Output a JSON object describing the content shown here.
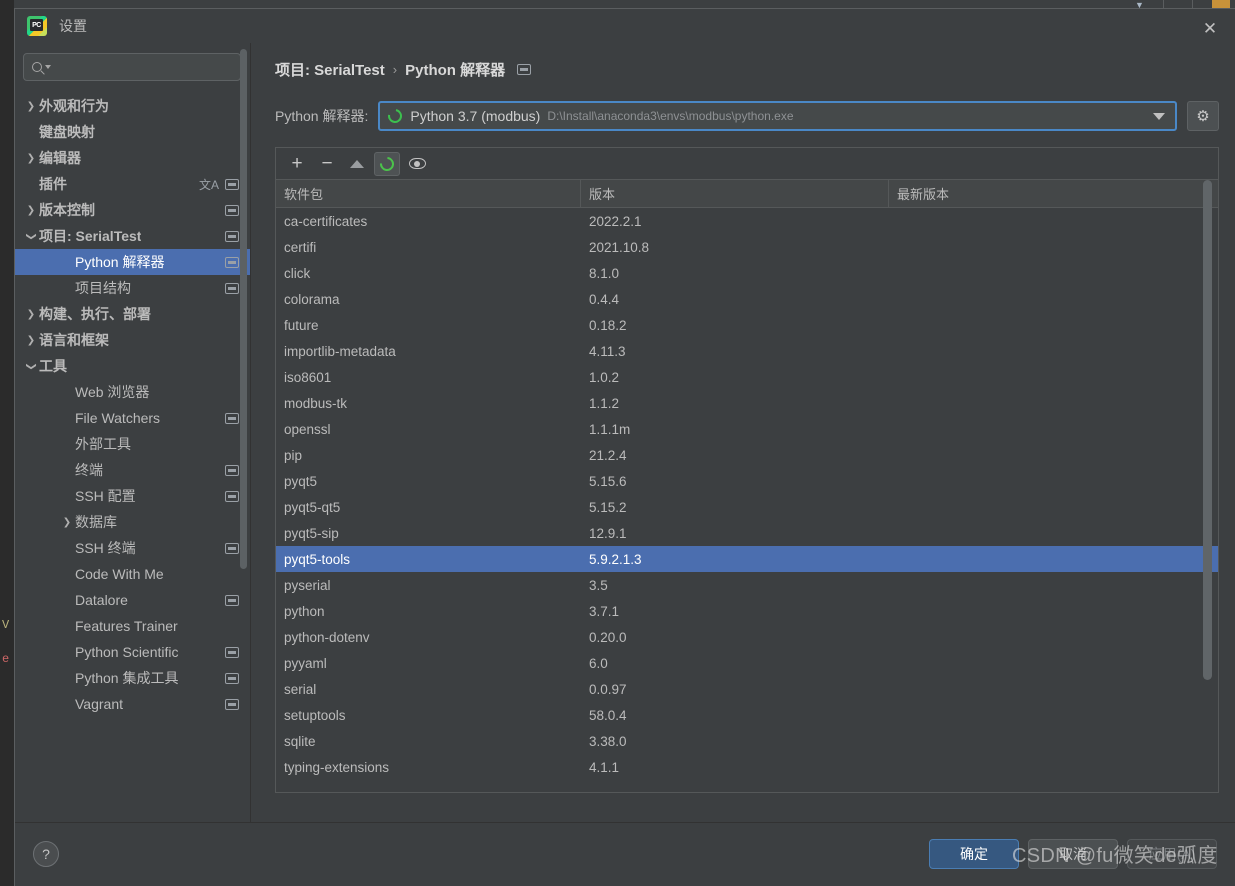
{
  "window": {
    "title": "设置",
    "app_icon": "pycharm-icon",
    "close_label": "✕"
  },
  "sidebar": {
    "search": {
      "value": "",
      "placeholder": ""
    },
    "items": [
      {
        "label": "外观和行为",
        "arrow": "collapsed",
        "indent": 0,
        "bold": true,
        "badge": "none",
        "selected": false
      },
      {
        "label": "键盘映射",
        "arrow": "none",
        "indent": 0,
        "bold": true,
        "badge": "none",
        "selected": false
      },
      {
        "label": "编辑器",
        "arrow": "collapsed",
        "indent": 0,
        "bold": true,
        "badge": "none",
        "selected": false
      },
      {
        "label": "插件",
        "arrow": "none",
        "indent": 0,
        "bold": true,
        "badge": "lang+mono",
        "selected": false
      },
      {
        "label": "版本控制",
        "arrow": "collapsed",
        "indent": 0,
        "bold": true,
        "badge": "mono",
        "selected": false
      },
      {
        "label": "项目: SerialTest",
        "arrow": "expanded",
        "indent": 0,
        "bold": true,
        "badge": "mono",
        "selected": false
      },
      {
        "label": "Python 解释器",
        "arrow": "none",
        "indent": 1,
        "bold": false,
        "badge": "mono",
        "selected": true
      },
      {
        "label": "项目结构",
        "arrow": "none",
        "indent": 1,
        "bold": false,
        "badge": "mono",
        "selected": false
      },
      {
        "label": "构建、执行、部署",
        "arrow": "collapsed",
        "indent": 0,
        "bold": true,
        "badge": "none",
        "selected": false
      },
      {
        "label": "语言和框架",
        "arrow": "collapsed",
        "indent": 0,
        "bold": true,
        "badge": "none",
        "selected": false
      },
      {
        "label": "工具",
        "arrow": "expanded",
        "indent": 0,
        "bold": true,
        "badge": "none",
        "selected": false
      },
      {
        "label": "Web 浏览器",
        "arrow": "none",
        "indent": 1,
        "bold": false,
        "badge": "none",
        "selected": false
      },
      {
        "label": "File Watchers",
        "arrow": "none",
        "indent": 1,
        "bold": false,
        "badge": "mono",
        "selected": false
      },
      {
        "label": "外部工具",
        "arrow": "none",
        "indent": 1,
        "bold": false,
        "badge": "none",
        "selected": false
      },
      {
        "label": "终端",
        "arrow": "none",
        "indent": 1,
        "bold": false,
        "badge": "mono",
        "selected": false
      },
      {
        "label": "SSH 配置",
        "arrow": "none",
        "indent": 1,
        "bold": false,
        "badge": "mono",
        "selected": false
      },
      {
        "label": "数据库",
        "arrow": "collapsed",
        "indent": 1,
        "bold": false,
        "badge": "none",
        "selected": false
      },
      {
        "label": "SSH 终端",
        "arrow": "none",
        "indent": 1,
        "bold": false,
        "badge": "mono",
        "selected": false
      },
      {
        "label": "Code With Me",
        "arrow": "none",
        "indent": 1,
        "bold": false,
        "badge": "none",
        "selected": false
      },
      {
        "label": "Datalore",
        "arrow": "none",
        "indent": 1,
        "bold": false,
        "badge": "mono",
        "selected": false
      },
      {
        "label": "Features Trainer",
        "arrow": "none",
        "indent": 1,
        "bold": false,
        "badge": "none",
        "selected": false
      },
      {
        "label": "Python Scientific",
        "arrow": "none",
        "indent": 1,
        "bold": false,
        "badge": "mono",
        "selected": false
      },
      {
        "label": "Python 集成工具",
        "arrow": "none",
        "indent": 1,
        "bold": false,
        "badge": "mono",
        "selected": false
      },
      {
        "label": "Vagrant",
        "arrow": "none",
        "indent": 1,
        "bold": false,
        "badge": "mono",
        "selected": false
      }
    ]
  },
  "content": {
    "breadcrumb": {
      "parent": "项目: SerialTest",
      "separator": "›",
      "current": "Python 解释器"
    },
    "interpreter": {
      "label": "Python 解释器:",
      "name": "Python 3.7 (modbus)",
      "path": "D:\\Install\\anaconda3\\envs\\modbus\\python.exe",
      "icon": "conda-env-icon"
    },
    "toolbar": {
      "add": "+",
      "remove": "−",
      "upgrade": "upgrade-arrow-icon",
      "refresh": "refresh-spinner-icon",
      "show_early": "eye-icon"
    },
    "packages_table": {
      "columns": [
        "软件包",
        "版本",
        "最新版本"
      ],
      "rows": [
        {
          "name": "ca-certificates",
          "version": "2022.2.1",
          "latest": "",
          "selected": false
        },
        {
          "name": "certifi",
          "version": "2021.10.8",
          "latest": "",
          "selected": false
        },
        {
          "name": "click",
          "version": "8.1.0",
          "latest": "",
          "selected": false
        },
        {
          "name": "colorama",
          "version": "0.4.4",
          "latest": "",
          "selected": false
        },
        {
          "name": "future",
          "version": "0.18.2",
          "latest": "",
          "selected": false
        },
        {
          "name": "importlib-metadata",
          "version": "4.11.3",
          "latest": "",
          "selected": false
        },
        {
          "name": "iso8601",
          "version": "1.0.2",
          "latest": "",
          "selected": false
        },
        {
          "name": "modbus-tk",
          "version": "1.1.2",
          "latest": "",
          "selected": false
        },
        {
          "name": "openssl",
          "version": "1.1.1m",
          "latest": "",
          "selected": false
        },
        {
          "name": "pip",
          "version": "21.2.4",
          "latest": "",
          "selected": false
        },
        {
          "name": "pyqt5",
          "version": "5.15.6",
          "latest": "",
          "selected": false
        },
        {
          "name": "pyqt5-qt5",
          "version": "5.15.2",
          "latest": "",
          "selected": false
        },
        {
          "name": "pyqt5-sip",
          "version": "12.9.1",
          "latest": "",
          "selected": false
        },
        {
          "name": "pyqt5-tools",
          "version": "5.9.2.1.3",
          "latest": "",
          "selected": true
        },
        {
          "name": "pyserial",
          "version": "3.5",
          "latest": "",
          "selected": false
        },
        {
          "name": "python",
          "version": "3.7.1",
          "latest": "",
          "selected": false
        },
        {
          "name": "python-dotenv",
          "version": "0.20.0",
          "latest": "",
          "selected": false
        },
        {
          "name": "pyyaml",
          "version": "6.0",
          "latest": "",
          "selected": false
        },
        {
          "name": "serial",
          "version": "0.0.97",
          "latest": "",
          "selected": false
        },
        {
          "name": "setuptools",
          "version": "58.0.4",
          "latest": "",
          "selected": false
        },
        {
          "name": "sqlite",
          "version": "3.38.0",
          "latest": "",
          "selected": false
        },
        {
          "name": "typing-extensions",
          "version": "4.1.1",
          "latest": "",
          "selected": false
        }
      ]
    }
  },
  "footer": {
    "help": "?",
    "ok": "确定",
    "cancel": "取消",
    "apply": "应用(A)"
  },
  "watermark": "CSDN @fu微笑de弧度",
  "background": {
    "code_fragment_1": "V",
    "code_fragment_2": "e"
  },
  "colors": {
    "accent": "#4b6eaf",
    "primary_button": "#365880",
    "panel": "#3c3f41",
    "field": "#45494a",
    "focus_border": "#4a88c7",
    "conda_green": "#3cbf4e",
    "text": "#bbbbbb"
  }
}
